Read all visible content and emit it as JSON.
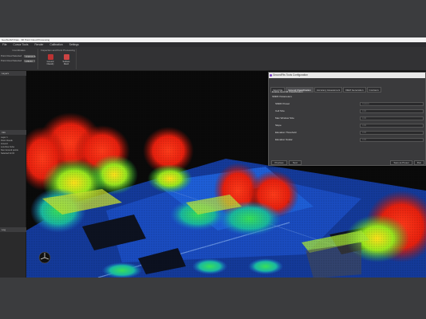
{
  "window": {
    "title": "GeoSLAM Draw - 3D Point Cloud Processing"
  },
  "menu": [
    "File",
    "Cursor Tools",
    "Render",
    "Calibration",
    "Settings"
  ],
  "ribbon": {
    "coord_group_title": "Coordinates",
    "coord_rows": [
      {
        "label": "Point Cloud Selected",
        "value": "3190319.13"
      },
      {
        "label": "Point Cloud Selected",
        "value": "4780.53"
      }
    ],
    "process_group_title": "Inspection and Point Processing",
    "buttons": [
      "Ground Classify",
      "Surface Mesh"
    ]
  },
  "left_panel": {
    "header": "Layers",
    "lower_header": "Info",
    "lines": [
      "Layer 1",
      "Point Clouds",
      "Ground",
      "Low Res Cube",
      "Non Ground points",
      "Selected for ID"
    ],
    "bottom_header": "Log"
  },
  "dialog": {
    "title": "GroundFits Tools Configuration",
    "tabs": [
      "Input File",
      "Ground Classification",
      "Accuracy Assessment",
      "DEM Generation",
      "Contours"
    ],
    "checkbox_label": "Enable Ground Classification",
    "section_label": "SMRF Parameters",
    "params": [
      {
        "label": "SMRF Preset",
        "value": "Custom"
      },
      {
        "label": "Cell Size",
        "value": "0.00"
      },
      {
        "label": "Max Window Size",
        "value": "0.00"
      },
      {
        "label": "Slope",
        "value": "0.00"
      },
      {
        "label": "Elevation Threshold",
        "value": "0.00"
      },
      {
        "label": "Elevation Scalar",
        "value": "0.00"
      }
    ],
    "buttons": {
      "previous": "Previous",
      "next": "Next",
      "save_preset": "Save as Preset",
      "run": "Run"
    }
  },
  "colors": {
    "accent": "#7a3fc7",
    "viewport_bg": "#0a0a0a"
  }
}
